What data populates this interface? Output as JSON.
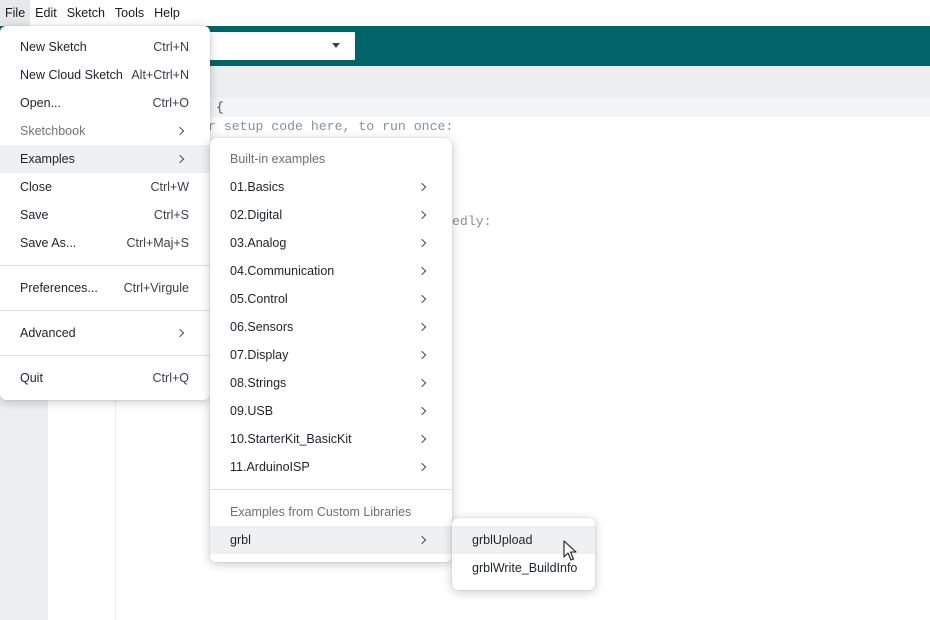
{
  "menubar": {
    "items": [
      "File",
      "Edit",
      "Sketch",
      "Tools",
      "Help"
    ],
    "active": "File"
  },
  "editor": {
    "line1": "{",
    "line2": "r setup code here, to run once:",
    "line3": "edly:"
  },
  "file_menu": {
    "items": [
      {
        "label": "New Sketch",
        "accel": "Ctrl+N"
      },
      {
        "label": "New Cloud Sketch",
        "accel": "Alt+Ctrl+N"
      },
      {
        "label": "Open...",
        "accel": "Ctrl+O"
      },
      {
        "label": "Sketchbook",
        "submenu": true,
        "disabled": true
      },
      {
        "label": "Examples",
        "submenu": true,
        "hovered": true
      },
      {
        "label": "Close",
        "accel": "Ctrl+W"
      },
      {
        "label": "Save",
        "accel": "Ctrl+S"
      },
      {
        "label": "Save As...",
        "accel": "Ctrl+Maj+S"
      },
      {
        "label": "Preferences...",
        "accel": "Ctrl+Virgule"
      },
      {
        "label": "Advanced",
        "submenu": true
      },
      {
        "label": "Quit",
        "accel": "Ctrl+Q"
      }
    ]
  },
  "examples_menu": {
    "builtin_heading": "Built-in examples",
    "builtin": [
      "01.Basics",
      "02.Digital",
      "03.Analog",
      "04.Communication",
      "05.Control",
      "06.Sensors",
      "07.Display",
      "08.Strings",
      "09.USB",
      "10.StarterKit_BasicKit",
      "11.ArduinoISP"
    ],
    "custom_heading": "Examples from Custom Libraries",
    "custom": [
      "grbl"
    ]
  },
  "grbl_menu": {
    "items": [
      "grblUpload",
      "grblWrite_BuildInfo"
    ]
  },
  "colors": {
    "toolbar": "#006468",
    "menu_hover": "#eef0f1"
  }
}
